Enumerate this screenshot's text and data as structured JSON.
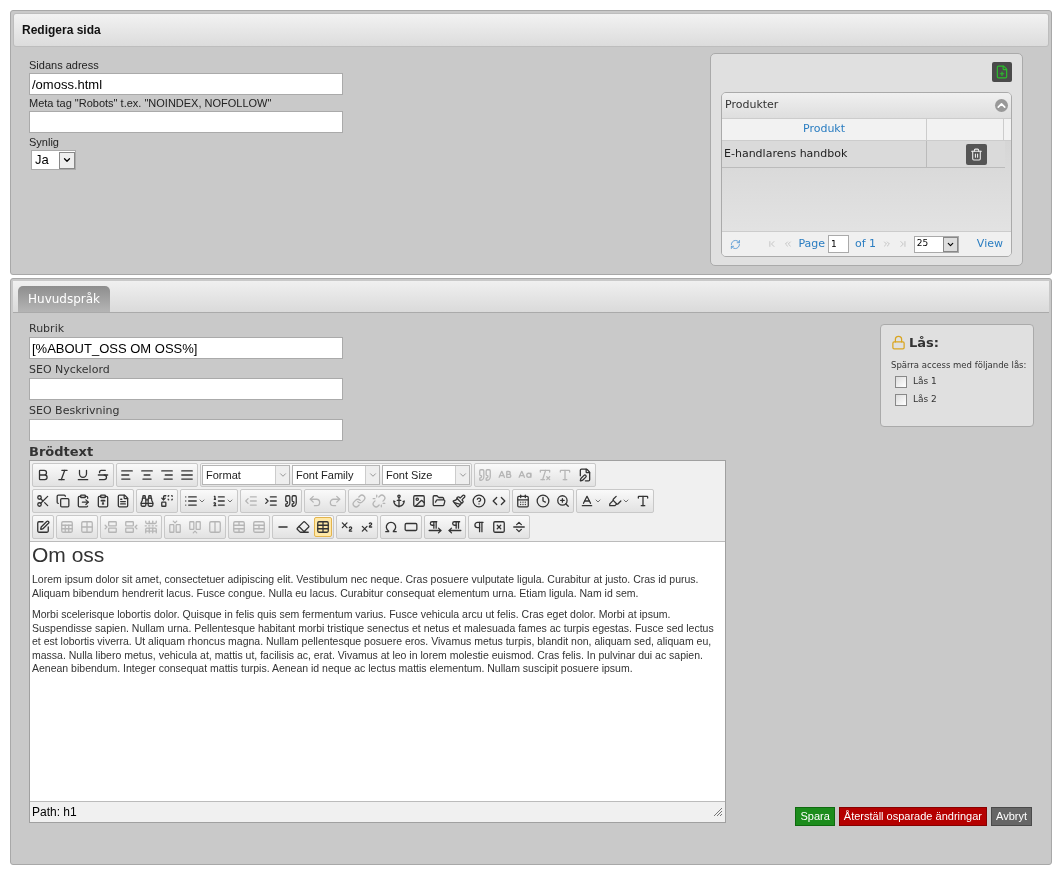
{
  "page_panel": {
    "title": "Redigera sida"
  },
  "page_fields": [
    {
      "label": "Sidans adress",
      "value": "/omoss.html"
    },
    {
      "label": "Meta tag \"Robots\" t.ex. \"NOINDEX, NOFOLLOW\""
    }
  ],
  "visible_select": {
    "label": "Synlig",
    "value": "Ja"
  },
  "products": {
    "title": "Produkter",
    "columns": [
      "Produkt"
    ],
    "rows": [
      {
        "name": "E-handlarens handbok"
      }
    ],
    "pager": {
      "page_label": "Page",
      "page": "1",
      "of": "of 1",
      "page_size": "25",
      "view": "View"
    }
  },
  "tabs": [
    {
      "label": "Huvudspråk",
      "selected": true
    }
  ],
  "content_fields": [
    {
      "label": "Rubrik",
      "value": "[%ABOUT_OSS OM OSS%]"
    },
    {
      "label": "SEO Nyckelord"
    },
    {
      "label": "SEO Beskrivning"
    }
  ],
  "body": {
    "label": "Brödtext",
    "toolbar": [
      [
        [
          {
            "kind": "bold",
            "disabled": false,
            "active": false
          },
          {
            "kind": "italic",
            "disabled": false,
            "active": false
          },
          {
            "kind": "underline",
            "disabled": false,
            "active": false
          },
          {
            "kind": "strikethrough",
            "disabled": false,
            "active": false
          }
        ],
        [
          {
            "kind": "alignleft",
            "disabled": false,
            "active": false
          },
          {
            "kind": "aligncenter",
            "disabled": false,
            "active": false
          },
          {
            "kind": "alignright",
            "disabled": false,
            "active": false
          },
          {
            "kind": "alignjustify",
            "disabled": false,
            "active": false
          }
        ],
        [
          {
            "kind": "select",
            "label": "Format"
          },
          {
            "kind": "select",
            "label": "Font Family"
          },
          {
            "kind": "select",
            "label": "Font Size"
          }
        ],
        [
          {
            "kind": "cite",
            "disabled": true,
            "active": false
          },
          {
            "kind": "abbr",
            "disabled": true,
            "active": false
          },
          {
            "kind": "acronym",
            "disabled": true,
            "active": false
          },
          {
            "kind": "del",
            "disabled": true,
            "active": false
          },
          {
            "kind": "ins",
            "disabled": true,
            "active": false
          },
          {
            "kind": "attribs",
            "disabled": false,
            "active": false
          }
        ]
      ],
      [
        [
          {
            "kind": "cut",
            "disabled": false,
            "active": false
          },
          {
            "kind": "copy",
            "disabled": false,
            "active": false
          },
          {
            "kind": "paste",
            "disabled": false,
            "active": false
          },
          {
            "kind": "pastetext",
            "disabled": false,
            "active": false
          },
          {
            "kind": "pasteword",
            "disabled": false,
            "active": false
          }
        ],
        [
          {
            "kind": "search",
            "disabled": false,
            "active": false
          },
          {
            "kind": "replace",
            "disabled": false,
            "active": false
          }
        ],
        [
          {
            "kind": "bullist",
            "disabled": false,
            "active": false
          },
          {
            "kind": "numlist",
            "disabled": false,
            "active": false
          }
        ],
        [
          {
            "kind": "outdent",
            "disabled": true,
            "active": false
          },
          {
            "kind": "indent",
            "disabled": false,
            "active": false
          },
          {
            "kind": "blockquote",
            "disabled": false,
            "active": false
          }
        ],
        [
          {
            "kind": "undo",
            "disabled": true,
            "active": false
          },
          {
            "kind": "redo",
            "disabled": true,
            "active": false
          }
        ],
        [
          {
            "kind": "link",
            "disabled": true,
            "active": false
          },
          {
            "kind": "unlink",
            "disabled": true,
            "active": false
          },
          {
            "kind": "anchor",
            "disabled": false,
            "active": false
          },
          {
            "kind": "image",
            "disabled": false,
            "active": false
          },
          {
            "kind": "filemanager",
            "disabled": false,
            "active": false
          },
          {
            "kind": "cleanup",
            "disabled": false,
            "active": false
          },
          {
            "kind": "help",
            "disabled": false,
            "active": false
          },
          {
            "kind": "code",
            "disabled": false,
            "active": false
          }
        ],
        [
          {
            "kind": "insertdate",
            "disabled": false,
            "active": false
          },
          {
            "kind": "inserttime",
            "disabled": false,
            "active": false
          },
          {
            "kind": "preview",
            "disabled": false,
            "active": false
          }
        ],
        [
          {
            "kind": "forecolor",
            "disabled": false,
            "active": false
          },
          {
            "kind": "backcolor",
            "disabled": false,
            "active": false
          },
          {
            "kind": "styleprops",
            "disabled": false,
            "active": false
          }
        ]
      ],
      [
        [
          {
            "kind": "visualaid",
            "disabled": false,
            "active": false
          }
        ],
        [
          {
            "kind": "rowprops",
            "disabled": true,
            "active": false
          },
          {
            "kind": "cellprops",
            "disabled": true,
            "active": false
          }
        ],
        [
          {
            "kind": "rowbefore",
            "disabled": true,
            "active": false
          },
          {
            "kind": "rowafter",
            "disabled": true,
            "active": false
          },
          {
            "kind": "deleterow",
            "disabled": true,
            "active": false
          }
        ],
        [
          {
            "kind": "colbefore",
            "disabled": true,
            "active": false
          },
          {
            "kind": "colafter",
            "disabled": true,
            "active": false
          },
          {
            "kind": "deletecol",
            "disabled": true,
            "active": false
          }
        ],
        [
          {
            "kind": "mergecells",
            "disabled": true,
            "active": false
          },
          {
            "kind": "splitcells",
            "disabled": true,
            "active": false
          }
        ],
        [
          {
            "kind": "hr",
            "disabled": false,
            "active": false
          },
          {
            "kind": "removeformat",
            "disabled": false,
            "active": false
          },
          {
            "kind": "table",
            "disabled": false,
            "active": true
          }
        ],
        [
          {
            "kind": "sub",
            "disabled": false,
            "active": false
          },
          {
            "kind": "sup",
            "disabled": false,
            "active": false
          }
        ],
        [
          {
            "kind": "charmap",
            "disabled": false,
            "active": false
          },
          {
            "kind": "advhr",
            "disabled": false,
            "active": false
          }
        ],
        [
          {
            "kind": "ltr",
            "disabled": false,
            "active": false
          },
          {
            "kind": "rtl",
            "disabled": false,
            "active": false
          }
        ],
        [
          {
            "kind": "visualchars",
            "disabled": false,
            "active": false
          },
          {
            "kind": "nonbreaking",
            "disabled": false,
            "active": false
          },
          {
            "kind": "pagebreak",
            "disabled": false,
            "active": false
          }
        ]
      ]
    ],
    "heading": "Om oss",
    "paragraphs": [
      "Lorem ipsum dolor sit amet, consectetuer adipiscing elit. Vestibulum nec neque. Cras posuere vulputate ligula. Curabitur at justo. Cras id purus. Aliquam bibendum hendrerit lacus. Fusce congue. Nulla eu lacus. Curabitur consequat elementum urna. Etiam ligula. Nam id sem.",
      "Morbi scelerisque lobortis dolor. Quisque in felis quis sem fermentum varius. Fusce vehicula arcu ut felis. Cras eget dolor. Morbi at ipsum. Suspendisse sapien. Nullam urna. Pellentesque habitant morbi tristique senectus et netus et malesuada fames ac turpis egestas. Fusce sed lectus et est lobortis viverra. Ut aliquam rhoncus magna. Nullam pellentesque posuere eros. Vivamus metus turpis, blandit non, aliquam sed, aliquam eu, massa. Nulla libero metus, vehicula at, mattis ut, facilisis ac, erat. Vivamus at leo in lorem molestie euismod. Cras felis. In pulvinar dui ac sapien. Aenean bibendum. Integer consequat mattis turpis. Aenean id neque ac lectus mattis elementum. Nullam suscipit posuere ipsum."
    ],
    "path": "Path: h1"
  },
  "locks": {
    "title": "Lås:",
    "hint": "Spärra access med följande lås:",
    "items": [
      {
        "label": "Lås 1",
        "checked": false
      },
      {
        "label": "Lås 2",
        "checked": false
      }
    ]
  },
  "buttons": [
    {
      "label": "Spara",
      "kind": "save"
    },
    {
      "label": "Återställ osparade ändringar",
      "kind": "reset"
    },
    {
      "label": "Avbryt",
      "kind": "cancel"
    }
  ]
}
